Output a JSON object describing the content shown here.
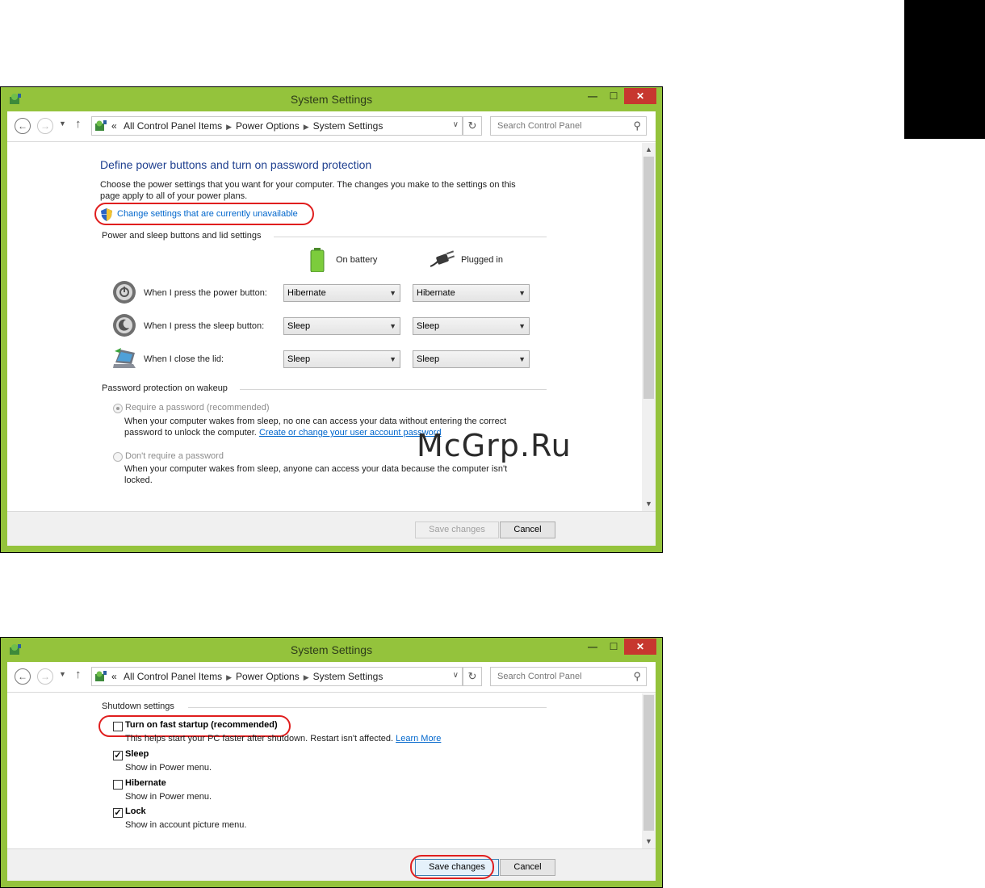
{
  "watermark": "McGrp.Ru",
  "window1": {
    "title": "System Settings",
    "breadcrumb": [
      "All Control Panel Items",
      "Power Options",
      "System Settings"
    ],
    "breadcrumb_prefix": "«",
    "search_placeholder": "Search Control Panel",
    "heading": "Define power buttons and turn on password protection",
    "intro_line1": "Choose the power settings that you want for your computer. The changes you make to the settings on this",
    "intro_line2": "page apply to all of your power plans.",
    "change_settings_link": "Change settings that are currently unavailable",
    "section_power": "Power and sleep buttons and lid settings",
    "col_battery": "On battery",
    "col_plugged": "Plugged in",
    "rows": [
      {
        "label": "When I press the power button:",
        "battery": "Hibernate",
        "plugged": "Hibernate"
      },
      {
        "label": "When I press the sleep button:",
        "battery": "Sleep",
        "plugged": "Sleep"
      },
      {
        "label": "When I close the lid:",
        "battery": "Sleep",
        "plugged": "Sleep"
      }
    ],
    "section_password": "Password protection on wakeup",
    "require_label": "Require a password (recommended)",
    "require_desc1": "When your computer wakes from sleep, no one can access your data without entering the correct",
    "require_desc2": "password to unlock the computer.",
    "require_link": "Create or change your user account password",
    "no_require_label": "Don't require a password",
    "no_require_desc1": "When your computer wakes from sleep, anyone can access your data because the computer isn't",
    "no_require_desc2": "locked.",
    "save_label": "Save changes",
    "cancel_label": "Cancel"
  },
  "window2": {
    "title": "System Settings",
    "breadcrumb": [
      "All Control Panel Items",
      "Power Options",
      "System Settings"
    ],
    "breadcrumb_prefix": "«",
    "search_placeholder": "Search Control Panel",
    "section_shutdown": "Shutdown settings",
    "options": [
      {
        "title": "Turn on fast startup (recommended)",
        "checked": false,
        "desc": "This helps start your PC faster after shutdown. Restart isn't affected.",
        "link": "Learn More"
      },
      {
        "title": "Sleep",
        "checked": true,
        "desc": "Show in Power menu."
      },
      {
        "title": "Hibernate",
        "checked": false,
        "desc": "Show in Power menu."
      },
      {
        "title": "Lock",
        "checked": true,
        "desc": "Show in account picture menu."
      }
    ],
    "save_label": "Save changes",
    "cancel_label": "Cancel"
  },
  "colors": {
    "frame": "#94c33c",
    "close": "#c7372f",
    "heading": "#1e3f8f",
    "link": "#0066cc",
    "highlight_ring": "#e01e1e"
  }
}
